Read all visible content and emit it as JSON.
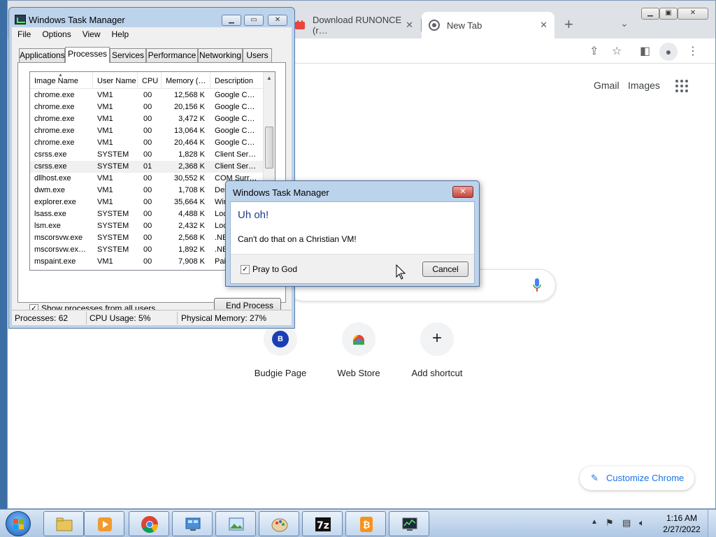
{
  "chrome": {
    "tabs": [
      {
        "title": "Download RUNONCE (r…",
        "icon": "youtube-like-icon"
      },
      {
        "title": "New Tab",
        "icon": "chrome-icon"
      }
    ],
    "new_tab_symbol": "+",
    "top_links": {
      "gmail": "Gmail",
      "images": "Images"
    },
    "shortcuts": [
      {
        "label": "Budgie Page",
        "icon_letter": "B"
      },
      {
        "label": "Web Store"
      },
      {
        "label": "Add shortcut",
        "symbol": "+"
      }
    ],
    "customize_label": "Customize Chrome"
  },
  "taskmgr": {
    "title": "Windows Task Manager",
    "menu": [
      "File",
      "Options",
      "View",
      "Help"
    ],
    "tabs": [
      "Applications",
      "Processes",
      "Services",
      "Performance",
      "Networking",
      "Users"
    ],
    "active_tab": "Processes",
    "columns": [
      "Image Name",
      "User Name",
      "CPU",
      "Memory (…",
      "Description"
    ],
    "rows": [
      {
        "image": "chrome.exe",
        "user": "VM1",
        "cpu": "00",
        "mem": "12,568 K",
        "desc": "Google C…"
      },
      {
        "image": "chrome.exe",
        "user": "VM1",
        "cpu": "00",
        "mem": "20,156 K",
        "desc": "Google C…"
      },
      {
        "image": "chrome.exe",
        "user": "VM1",
        "cpu": "00",
        "mem": "3,472 K",
        "desc": "Google C…"
      },
      {
        "image": "chrome.exe",
        "user": "VM1",
        "cpu": "00",
        "mem": "13,064 K",
        "desc": "Google C…"
      },
      {
        "image": "chrome.exe",
        "user": "VM1",
        "cpu": "00",
        "mem": "20,464 K",
        "desc": "Google C…"
      },
      {
        "image": "csrss.exe",
        "user": "SYSTEM",
        "cpu": "00",
        "mem": "1,828 K",
        "desc": "Client Ser…"
      },
      {
        "image": "csrss.exe",
        "user": "SYSTEM",
        "cpu": "01",
        "mem": "2,368 K",
        "desc": "Client Ser…"
      },
      {
        "image": "dllhost.exe",
        "user": "VM1",
        "cpu": "00",
        "mem": "30,552 K",
        "desc": "COM Surr…"
      },
      {
        "image": "dwm.exe",
        "user": "VM1",
        "cpu": "00",
        "mem": "1,708 K",
        "desc": "Desk…"
      },
      {
        "image": "explorer.exe",
        "user": "VM1",
        "cpu": "00",
        "mem": "35,664 K",
        "desc": "Wind…"
      },
      {
        "image": "lsass.exe",
        "user": "SYSTEM",
        "cpu": "00",
        "mem": "4,488 K",
        "desc": "Loca…"
      },
      {
        "image": "lsm.exe",
        "user": "SYSTEM",
        "cpu": "00",
        "mem": "2,432 K",
        "desc": "Loca…"
      },
      {
        "image": "mscorsvw.exe",
        "user": "SYSTEM",
        "cpu": "00",
        "mem": "2,568 K",
        "desc": ".NET…"
      },
      {
        "image": "mscorsvw.ex…",
        "user": "SYSTEM",
        "cpu": "00",
        "mem": "1,892 K",
        "desc": ".NET…"
      },
      {
        "image": "mspaint.exe",
        "user": "VM1",
        "cpu": "00",
        "mem": "7,908 K",
        "desc": "Paint"
      }
    ],
    "show_all_label": "Show processes from all users",
    "show_all_checked": true,
    "end_process_label": "End Process",
    "status": {
      "processes": "Processes: 62",
      "cpu": "CPU Usage: 5%",
      "memory": "Physical Memory: 27%"
    }
  },
  "dialog": {
    "title": "Windows Task Manager",
    "close_symbol": "✕",
    "heading": "Uh oh!",
    "message": "Can't do that on a Christian VM!",
    "checkbox_label": "Pray to God",
    "checkbox_checked": true,
    "cancel_label": "Cancel"
  },
  "taskbar": {
    "apps": [
      "explorer-icon",
      "media-player-icon",
      "chrome-icon",
      "control-panel-icon",
      "photo-viewer-icon",
      "paint-icon",
      "7zip-icon",
      "bitcoin-icon",
      "task-manager-icon"
    ],
    "clock_time": "1:16 AM",
    "clock_date": "2/27/2022"
  }
}
